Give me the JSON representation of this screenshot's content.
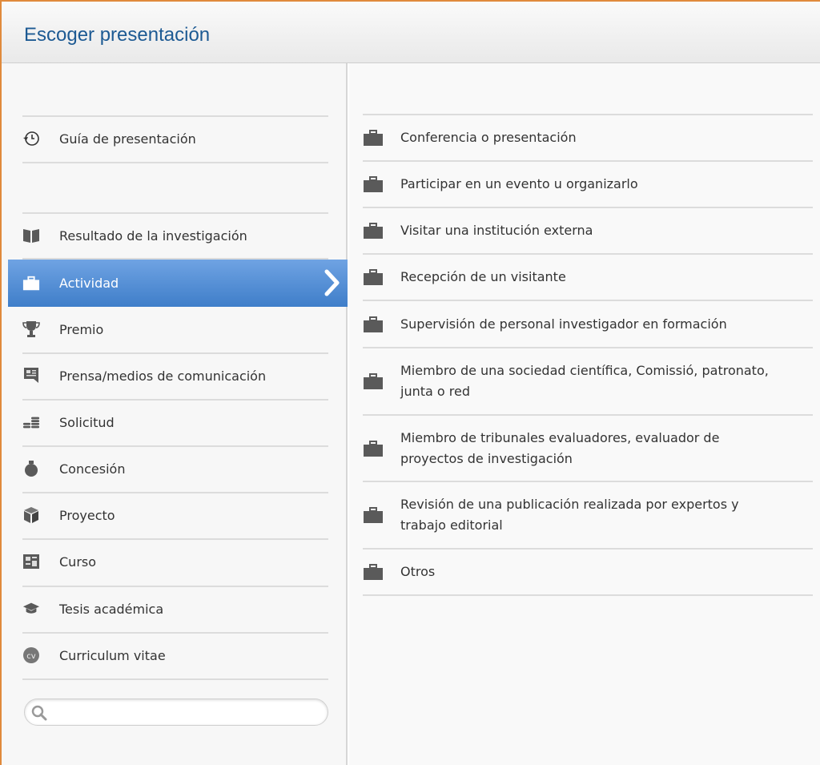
{
  "window": {
    "title": "Escoger presentación"
  },
  "left_menu": {
    "guide": {
      "label": "Guía de presentación",
      "icon": "history-icon"
    },
    "items": [
      {
        "label": "Resultado de la investigación",
        "icon": "book-icon"
      },
      {
        "label": "Actividad",
        "icon": "briefcase-icon",
        "selected": true
      },
      {
        "label": "Premio",
        "icon": "trophy-icon"
      },
      {
        "label": "Prensa/medios de comunicación",
        "icon": "press-icon"
      },
      {
        "label": "Solicitud",
        "icon": "coins-icon"
      },
      {
        "label": "Concesión",
        "icon": "money-bag-icon"
      },
      {
        "label": "Proyecto",
        "icon": "cube-icon"
      },
      {
        "label": "Curso",
        "icon": "course-icon"
      },
      {
        "label": "Tesis académica",
        "icon": "graduation-cap-icon"
      },
      {
        "label": "Curriculum vitae",
        "icon": "cv-icon"
      }
    ],
    "search": {
      "placeholder": "",
      "value": ""
    }
  },
  "right_menu": {
    "items": [
      {
        "label": "Conferencia o presentación"
      },
      {
        "label": "Participar en un evento u organizarlo"
      },
      {
        "label": "Visitar una institución externa"
      },
      {
        "label": "Recepción de un visitante"
      },
      {
        "label": "Supervisión de personal investigador en formación"
      },
      {
        "label": "Miembro de una sociedad científica, Comissió, patronato, junta o red"
      },
      {
        "label": "Miembro de tribunales evaluadores, evaluador de proyectos de investigación"
      },
      {
        "label": "Revisión de una publicación realizada por expertos y trabajo editorial"
      },
      {
        "label": "Otros"
      }
    ]
  },
  "colors": {
    "accent": "#4a88d2",
    "title": "#1d5a93",
    "frame": "#e08a3c",
    "icon": "#5a5a5a"
  }
}
